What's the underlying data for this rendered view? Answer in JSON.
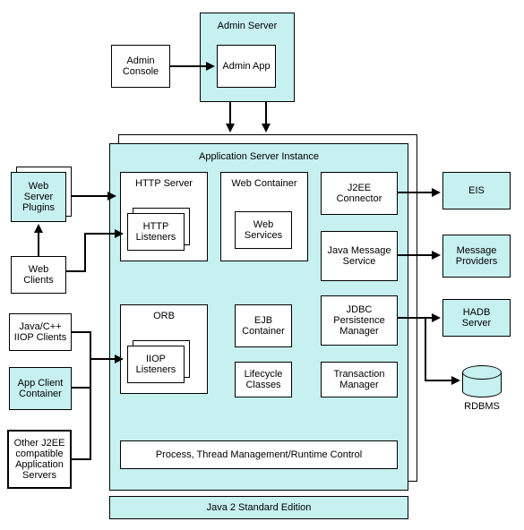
{
  "admin_server": "Admin Server",
  "admin_console": "Admin Console",
  "admin_app": "Admin App",
  "app_server_instance": "Application Server Instance",
  "http_server": "HTTP Server",
  "http_listeners": "HTTP Listeners",
  "web_container": "Web Container",
  "web_services": "Web Services",
  "j2ee_connector": "J2EE Connector",
  "java_message": "Java Message Service",
  "orb": "ORB",
  "iiop_listeners": "IIOP Listeners",
  "ejb_container": "EJB Container",
  "lifecycle": "Lifecycle Classes",
  "jdbc": "JDBC Persistence Manager",
  "transaction": "Transaction Manager",
  "process_thread": "Process, Thread Management/Runtime Control",
  "java2": "Java 2 Standard Edition",
  "web_server_plugins": "Web Server Plugins",
  "web_clients": "Web Clients",
  "java_cpp": "Java/C++ IIOP Clients",
  "app_client_container": "App Client Container",
  "other_j2ee": "Other J2EE compatible Application Servers",
  "eis": "EIS",
  "message_providers": "Message Providers",
  "hadb": "HADB Server",
  "rdbms": "RDBMS"
}
